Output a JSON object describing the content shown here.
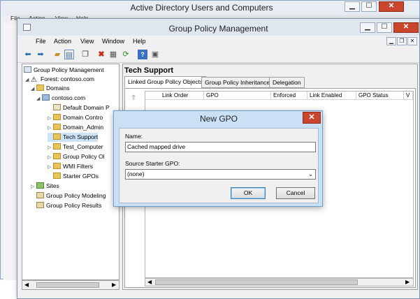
{
  "ad_window": {
    "title": "Active Directory Users and Computers",
    "menu": [
      "File",
      "Action",
      "View",
      "Help"
    ]
  },
  "gpm_window": {
    "title": "Group Policy Management",
    "menu": [
      "File",
      "Action",
      "View",
      "Window",
      "Help"
    ]
  },
  "tree": {
    "items": [
      {
        "label": "Group Policy Management"
      },
      {
        "label": "Forest: contoso.com"
      },
      {
        "label": "Domains"
      },
      {
        "label": "contoso.com"
      },
      {
        "label": "Default Domain P"
      },
      {
        "label": "Domain Contro"
      },
      {
        "label": "Domain_Admin"
      },
      {
        "label": "Tech Support"
      },
      {
        "label": "Test_Computer"
      },
      {
        "label": "Group Policy Ol"
      },
      {
        "label": "WMI Filters"
      },
      {
        "label": "Starter GPOs"
      },
      {
        "label": "Sites"
      },
      {
        "label": "Group Policy Modeling"
      },
      {
        "label": "Group Policy Results"
      }
    ]
  },
  "right_pane": {
    "header": "Tech Support",
    "tabs": [
      "Linked Group Policy Objects",
      "Group Policy Inheritance",
      "Delegation"
    ],
    "columns": [
      "Link Order",
      "GPO",
      "Enforced",
      "Link Enabled",
      "GPO Status",
      "V"
    ]
  },
  "dialog": {
    "title": "New GPO",
    "name_label": "Name:",
    "name_value": "Cached mapped drive",
    "starter_label": "Source Starter GPO:",
    "starter_value": "(none)",
    "ok_label": "OK",
    "cancel_label": "Cancel"
  },
  "colors": {
    "close_red": "#c9462c",
    "dialog_frame": "#c9e0f5",
    "selection": "#cde4f7"
  }
}
